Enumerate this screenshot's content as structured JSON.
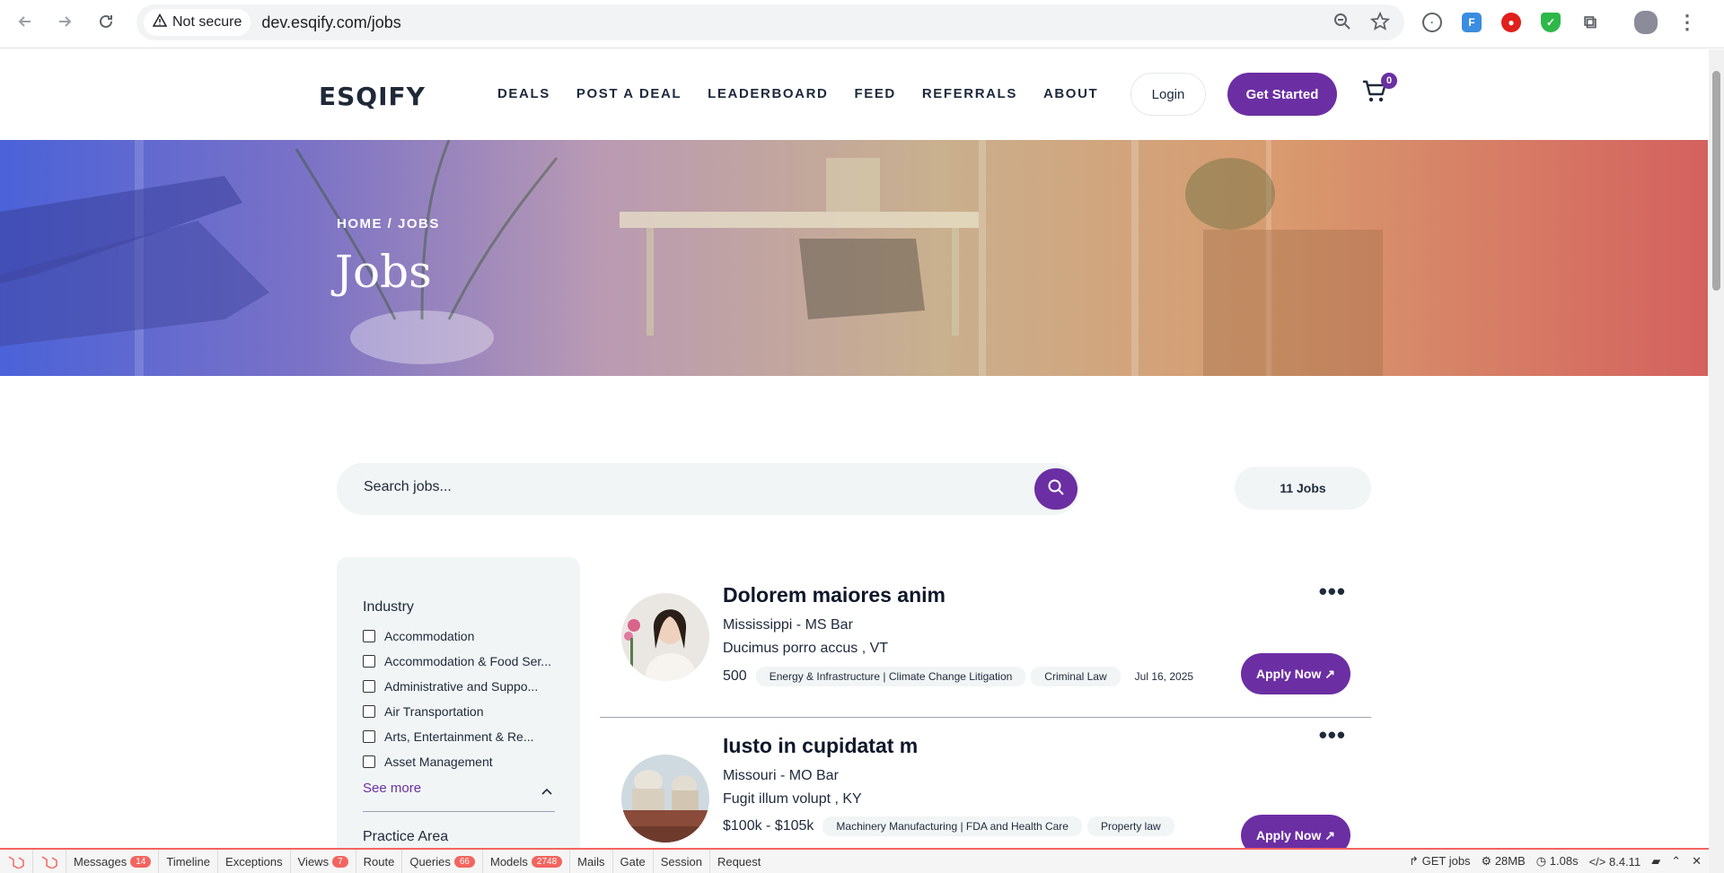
{
  "browser": {
    "security_label": "Not secure",
    "url": "dev.esqify.com/jobs"
  },
  "header": {
    "logo": "ESQIFY",
    "nav": [
      "DEALS",
      "POST A DEAL",
      "LEADERBOARD",
      "FEED",
      "REFERRALS",
      "ABOUT"
    ],
    "login_label": "Login",
    "get_started_label": "Get Started",
    "cart_count": "0"
  },
  "hero": {
    "breadcrumb": "HOME / JOBS",
    "title": "Jobs"
  },
  "search": {
    "placeholder": "Search jobs...",
    "count_label": "11 Jobs"
  },
  "sidebar": {
    "industry_title": "Industry",
    "industry_items": [
      "Accommodation",
      "Accommodation & Food Ser...",
      "Administrative and Suppo...",
      "Air Transportation",
      "Arts, Entertainment & Re...",
      "Asset Management"
    ],
    "see_more_label": "See more",
    "practice_area_title": "Practice Area"
  },
  "jobs": [
    {
      "title": "Dolorem maiores anim",
      "bar": "Mississippi - MS Bar",
      "location": "Ducimus porro accus , VT",
      "salary": "500",
      "tags": [
        "Energy & Infrastructure | Climate Change Litigation",
        "Criminal Law"
      ],
      "date": "Jul 16, 2025",
      "apply_label": "Apply Now ↗"
    },
    {
      "title": "Iusto in cupidatat m",
      "bar": "Missouri - MO Bar",
      "location": "Fugit illum volupt , KY",
      "salary": "$100k - $105k",
      "tags": [
        "Machinery Manufacturing | FDA and Health Care",
        "Property law"
      ],
      "date": "",
      "apply_label": "Apply Now ↗"
    }
  ],
  "debugbar": {
    "items": [
      {
        "label": "Messages",
        "badge": "14"
      },
      {
        "label": "Timeline",
        "badge": ""
      },
      {
        "label": "Exceptions",
        "badge": ""
      },
      {
        "label": "Views",
        "badge": "7"
      },
      {
        "label": "Route",
        "badge": ""
      },
      {
        "label": "Queries",
        "badge": "66"
      },
      {
        "label": "Models",
        "badge": "2748"
      },
      {
        "label": "Mails",
        "badge": ""
      },
      {
        "label": "Gate",
        "badge": ""
      },
      {
        "label": "Session",
        "badge": ""
      },
      {
        "label": "Request",
        "badge": ""
      }
    ],
    "route": "GET jobs",
    "memory": "28MB",
    "time": "1.08s",
    "php_version": "8.4.11"
  },
  "colors": {
    "brand_purple": "#6b2fa3",
    "debug_red": "#f4645f"
  }
}
